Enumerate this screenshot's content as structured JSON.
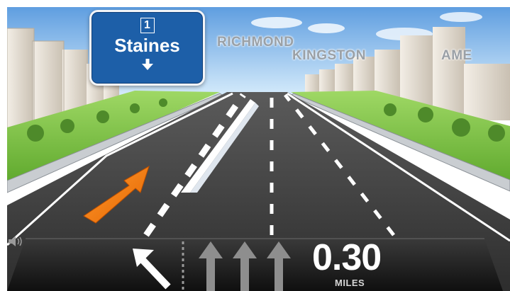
{
  "sign": {
    "road_number": "1",
    "destination": "Staines",
    "arrow_icon": "down-arrow-icon"
  },
  "city_labels": {
    "first": "RICHMOND",
    "second": "KINGSTON",
    "third": "AME"
  },
  "guidance": {
    "distance": "0.30",
    "unit": "MILES",
    "turn_icon": "bear-left-arrow-icon",
    "lane_icons": [
      "straight-lane-arrow-icon",
      "straight-lane-arrow-icon",
      "straight-lane-arrow-icon"
    ],
    "volume_icon": "speaker-icon"
  },
  "colors": {
    "sign_blue": "#1d5fa8",
    "route_arrow": "#f07a10",
    "sky": "#9ecbee",
    "grass": "#7fc843",
    "road": "#3a3a3a"
  }
}
